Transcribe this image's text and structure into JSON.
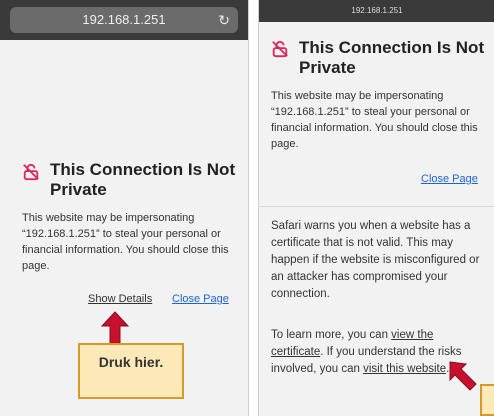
{
  "left": {
    "url": "192.168.1.251",
    "title": "This Connection Is Not Private",
    "body": "This website may be impersonating “192.168.1.251” to steal your personal or financial information. You should close this page.",
    "show_details": "Show Details",
    "close_page": "Close Page",
    "callout": "Druk hier."
  },
  "right": {
    "url": "192.168.1.251",
    "title": "This Connection Is Not Private",
    "body": "This website may be impersonating “192.168.1.251” to steal your personal or financial information. You should close this page.",
    "close_page": "Close Page",
    "details_1": "Safari warns you when a website has a certificate that is not valid. This may happen if the website is misconfigured or an attacker has compromised your connection.",
    "details_2_prefix": "To learn more, you can ",
    "view_certificate": "view the certificate",
    "details_2_middle": ". If you understand the risks involved, you can ",
    "visit_website": "visit this website",
    "details_2_suffix": "."
  },
  "colors": {
    "link": "#1e63d6",
    "callout_bg": "#fde9b8",
    "callout_border": "#d59a2a",
    "arrow": "#c8102e",
    "warning_icon": "#e0245e"
  },
  "icons": {
    "warning": "broken-lock-icon",
    "reload": "reload-icon"
  }
}
